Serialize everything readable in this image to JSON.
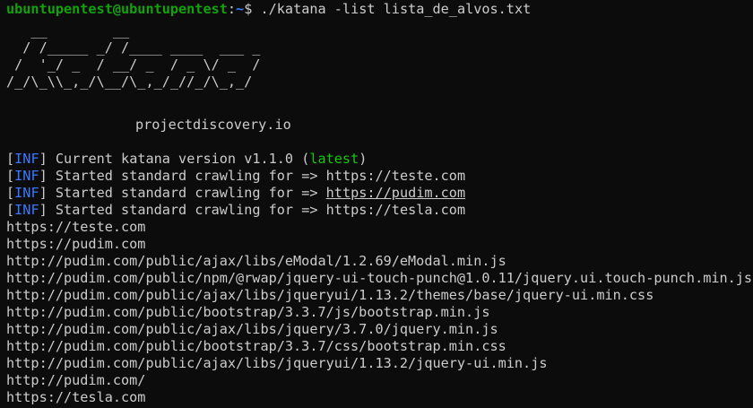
{
  "colors": {
    "background": "#0c0c0c",
    "foreground": "#cccccc",
    "prompt_user": "#13a10e",
    "prompt_path": "#3b78ff",
    "info_tag": "#3b78ff",
    "latest": "#16c60c"
  },
  "prompt": {
    "user_host": "ubuntupentest@ubuntupentest",
    "separator": ":",
    "path": "~",
    "symbol": "$ ",
    "command": "./katana -list lista_de_alvos.txt"
  },
  "banner": {
    "ascii": [
      "   __        __",
      "  / /_____ _/ /____ ____  ___ _",
      " /  '_/ _  / __/ _  / _ \\/ _  /",
      "/_/\\_\\\\_,_/\\__/\\_,_/_//_/\\_,_/"
    ],
    "brand": "projectdiscovery.io"
  },
  "logs": [
    {
      "tag": "INF",
      "before": "Current katana version v1.1.0 (",
      "highlight": "latest",
      "after": ")",
      "link": ""
    },
    {
      "tag": "INF",
      "before": "Started standard crawling for => ",
      "highlight": "",
      "after": "",
      "link": "https://teste.com",
      "underline": false
    },
    {
      "tag": "INF",
      "before": "Started standard crawling for => ",
      "highlight": "",
      "after": "",
      "link": "https://pudim.com",
      "underline": true
    },
    {
      "tag": "INF",
      "before": "Started standard crawling for => ",
      "highlight": "",
      "after": "",
      "link": "https://tesla.com",
      "underline": false
    }
  ],
  "results": [
    "https://teste.com",
    "https://pudim.com",
    "http://pudim.com/public/ajax/libs/eModal/1.2.69/eModal.min.js",
    "http://pudim.com/public/npm/@rwap/jquery-ui-touch-punch@1.0.11/jquery.ui.touch-punch.min.js",
    "http://pudim.com/public/ajax/libs/jqueryui/1.13.2/themes/base/jquery-ui.min.css",
    "http://pudim.com/public/bootstrap/3.3.7/js/bootstrap.min.js",
    "http://pudim.com/public/ajax/libs/jquery/3.7.0/jquery.min.js",
    "http://pudim.com/public/bootstrap/3.3.7/css/bootstrap.min.css",
    "http://pudim.com/public/ajax/libs/jqueryui/1.13.2/jquery-ui.min.js",
    "http://pudim.com/",
    "https://tesla.com"
  ]
}
